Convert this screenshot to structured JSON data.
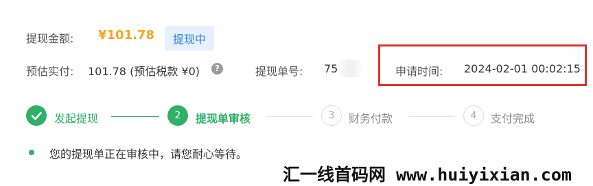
{
  "withdrawal": {
    "amount_label": "提现金额:",
    "amount_value": "¥101.78",
    "status_badge": "提现中",
    "estimated_label": "预估实付:",
    "estimated_value": "101.78 (预估税款 ¥0)",
    "order_label": "提现单号:",
    "order_value": "75",
    "apply_time_label": "申请时间:",
    "apply_time_value": "2024-02-01 00:02:15"
  },
  "steps": [
    {
      "label": "发起提现",
      "status": "done",
      "icon": "check-icon"
    },
    {
      "label": "提现单审核",
      "number": "2",
      "status": "active"
    },
    {
      "label": "财务付款",
      "number": "3",
      "status": "pending"
    },
    {
      "label": "支付完成",
      "number": "4",
      "status": "pending"
    }
  ],
  "status_message": "您的提现单正在审核中，请您耐心等待。",
  "watermark": "汇一线首码网 www.huiyixian.com",
  "colors": {
    "accent_green": "#2fb067",
    "amount_orange": "#f5a623",
    "badge_blue": "#2f7fe0",
    "highlight_red": "#d9342b"
  }
}
